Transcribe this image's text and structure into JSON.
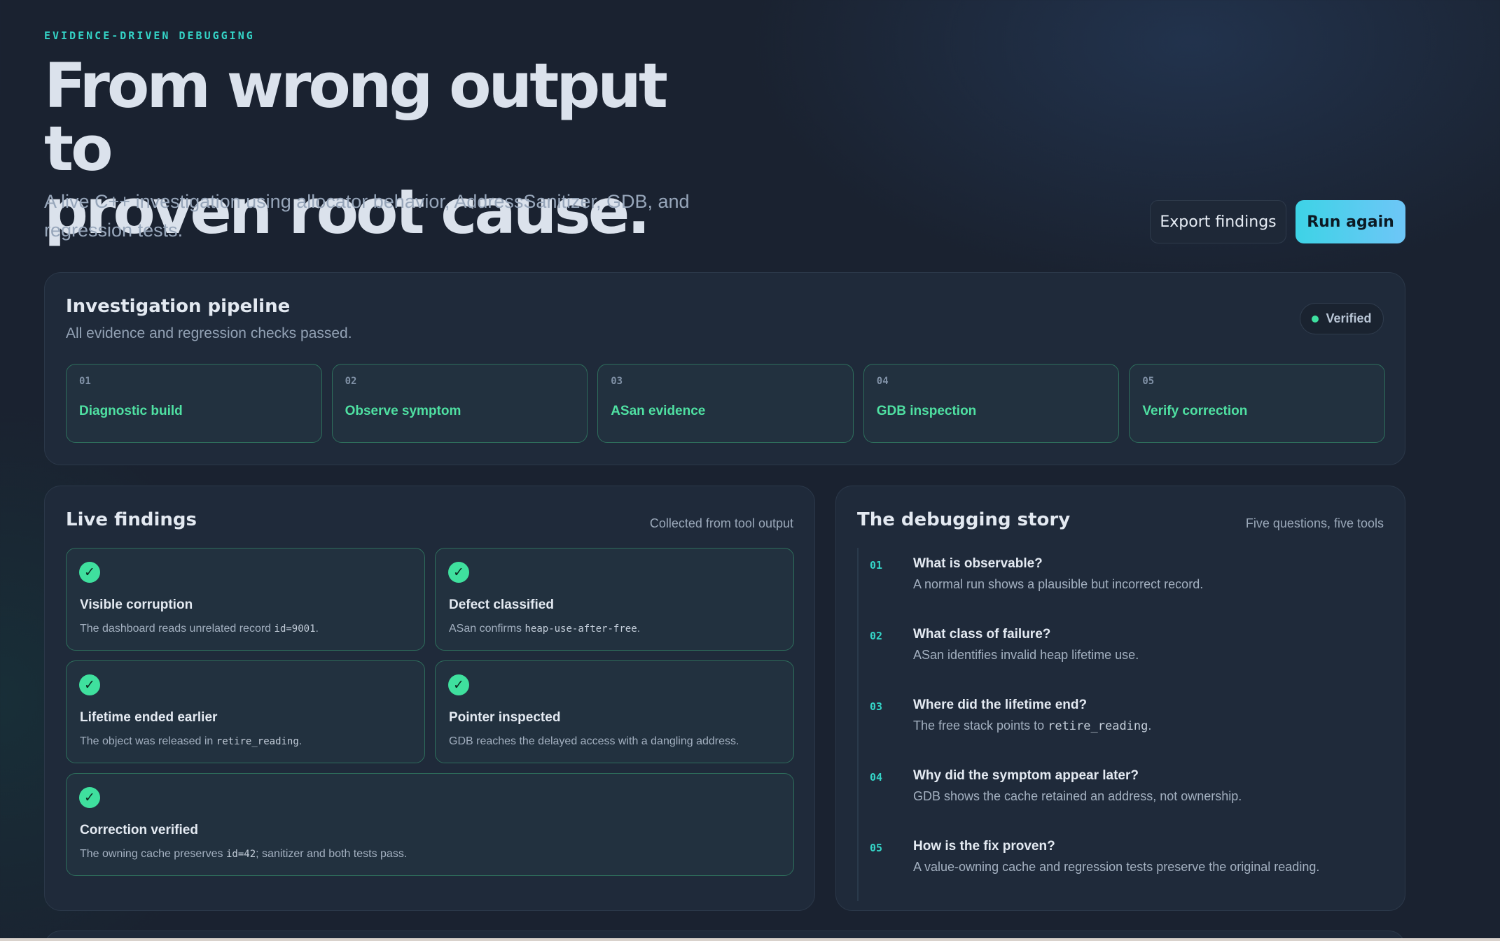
{
  "hero": {
    "eyebrow": "EVIDENCE-DRIVEN DEBUGGING",
    "title_line1": "From wrong output to",
    "title_line2": "proven root cause.",
    "subtitle": "A live C++ investigation using allocator behavior, AddressSanitizer, GDB, and regression tests.",
    "export_label": "Export findings",
    "run_label": "Run again"
  },
  "pipeline": {
    "title": "Investigation pipeline",
    "subtitle": "All evidence and regression checks passed.",
    "badge": "Verified",
    "steps": [
      {
        "num": "01",
        "label": "Diagnostic build"
      },
      {
        "num": "02",
        "label": "Observe symptom"
      },
      {
        "num": "03",
        "label": "ASan evidence"
      },
      {
        "num": "04",
        "label": "GDB inspection"
      },
      {
        "num": "05",
        "label": "Verify correction"
      }
    ]
  },
  "findings": {
    "title": "Live findings",
    "meta": "Collected from tool output",
    "check_icon": "✓",
    "cards": [
      {
        "title": "Visible corruption",
        "pre": "The dashboard reads unrelated record ",
        "code": "id=9001",
        "post": "."
      },
      {
        "title": "Defect classified",
        "pre": "ASan confirms ",
        "code": "heap-use-after-free",
        "post": "."
      },
      {
        "title": "Lifetime ended earlier",
        "pre": "The object was released in ",
        "code": "retire_reading",
        "post": "."
      },
      {
        "title": "Pointer inspected",
        "pre": "GDB reaches the delayed access with a dangling address.",
        "code": "",
        "post": ""
      },
      {
        "title": "Correction verified",
        "pre": "The owning cache preserves ",
        "code": "id=42",
        "post": "; sanitizer and both tests pass."
      }
    ]
  },
  "story": {
    "title": "The debugging story",
    "meta": "Five questions, five tools",
    "items": [
      {
        "num": "01",
        "q": "What is observable?",
        "pre": "A normal run shows a plausible but incorrect record.",
        "code": "",
        "post": ""
      },
      {
        "num": "02",
        "q": "What class of failure?",
        "pre": "ASan identifies invalid heap lifetime use.",
        "code": "",
        "post": ""
      },
      {
        "num": "03",
        "q": "Where did the lifetime end?",
        "pre": "The free stack points to ",
        "code": "retire_reading",
        "post": "."
      },
      {
        "num": "04",
        "q": "Why did the symptom appear later?",
        "pre": "GDB shows the cache retained an address, not ownership.",
        "code": "",
        "post": ""
      },
      {
        "num": "05",
        "q": "How is the fix proven?",
        "pre": "A value-owning cache and regression tests preserve the original reading.",
        "code": "",
        "post": ""
      }
    ]
  },
  "colors": {
    "accent_cyan": "#34d3c6",
    "success_green": "#4fe0a2",
    "background": "#1a2230",
    "panel": "#1f2a3a"
  }
}
